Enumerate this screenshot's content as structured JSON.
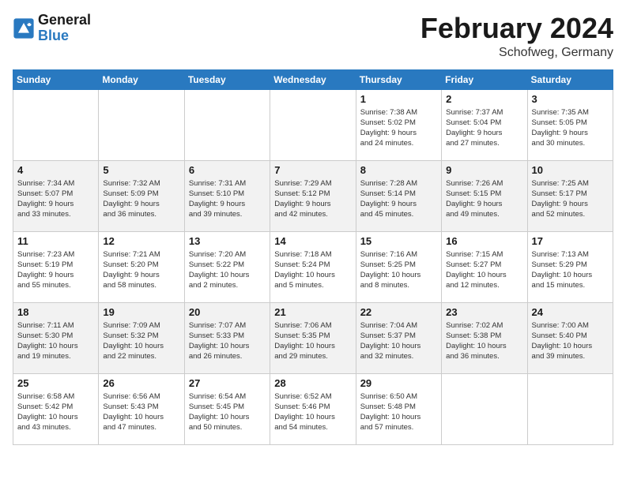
{
  "header": {
    "logo_line1": "General",
    "logo_line2": "Blue",
    "month_title": "February 2024",
    "location": "Schofweg, Germany"
  },
  "days_of_week": [
    "Sunday",
    "Monday",
    "Tuesday",
    "Wednesday",
    "Thursday",
    "Friday",
    "Saturday"
  ],
  "weeks": [
    [
      {
        "day": "",
        "info": ""
      },
      {
        "day": "",
        "info": ""
      },
      {
        "day": "",
        "info": ""
      },
      {
        "day": "",
        "info": ""
      },
      {
        "day": "1",
        "info": "Sunrise: 7:38 AM\nSunset: 5:02 PM\nDaylight: 9 hours\nand 24 minutes."
      },
      {
        "day": "2",
        "info": "Sunrise: 7:37 AM\nSunset: 5:04 PM\nDaylight: 9 hours\nand 27 minutes."
      },
      {
        "day": "3",
        "info": "Sunrise: 7:35 AM\nSunset: 5:05 PM\nDaylight: 9 hours\nand 30 minutes."
      }
    ],
    [
      {
        "day": "4",
        "info": "Sunrise: 7:34 AM\nSunset: 5:07 PM\nDaylight: 9 hours\nand 33 minutes."
      },
      {
        "day": "5",
        "info": "Sunrise: 7:32 AM\nSunset: 5:09 PM\nDaylight: 9 hours\nand 36 minutes."
      },
      {
        "day": "6",
        "info": "Sunrise: 7:31 AM\nSunset: 5:10 PM\nDaylight: 9 hours\nand 39 minutes."
      },
      {
        "day": "7",
        "info": "Sunrise: 7:29 AM\nSunset: 5:12 PM\nDaylight: 9 hours\nand 42 minutes."
      },
      {
        "day": "8",
        "info": "Sunrise: 7:28 AM\nSunset: 5:14 PM\nDaylight: 9 hours\nand 45 minutes."
      },
      {
        "day": "9",
        "info": "Sunrise: 7:26 AM\nSunset: 5:15 PM\nDaylight: 9 hours\nand 49 minutes."
      },
      {
        "day": "10",
        "info": "Sunrise: 7:25 AM\nSunset: 5:17 PM\nDaylight: 9 hours\nand 52 minutes."
      }
    ],
    [
      {
        "day": "11",
        "info": "Sunrise: 7:23 AM\nSunset: 5:19 PM\nDaylight: 9 hours\nand 55 minutes."
      },
      {
        "day": "12",
        "info": "Sunrise: 7:21 AM\nSunset: 5:20 PM\nDaylight: 9 hours\nand 58 minutes."
      },
      {
        "day": "13",
        "info": "Sunrise: 7:20 AM\nSunset: 5:22 PM\nDaylight: 10 hours\nand 2 minutes."
      },
      {
        "day": "14",
        "info": "Sunrise: 7:18 AM\nSunset: 5:24 PM\nDaylight: 10 hours\nand 5 minutes."
      },
      {
        "day": "15",
        "info": "Sunrise: 7:16 AM\nSunset: 5:25 PM\nDaylight: 10 hours\nand 8 minutes."
      },
      {
        "day": "16",
        "info": "Sunrise: 7:15 AM\nSunset: 5:27 PM\nDaylight: 10 hours\nand 12 minutes."
      },
      {
        "day": "17",
        "info": "Sunrise: 7:13 AM\nSunset: 5:29 PM\nDaylight: 10 hours\nand 15 minutes."
      }
    ],
    [
      {
        "day": "18",
        "info": "Sunrise: 7:11 AM\nSunset: 5:30 PM\nDaylight: 10 hours\nand 19 minutes."
      },
      {
        "day": "19",
        "info": "Sunrise: 7:09 AM\nSunset: 5:32 PM\nDaylight: 10 hours\nand 22 minutes."
      },
      {
        "day": "20",
        "info": "Sunrise: 7:07 AM\nSunset: 5:33 PM\nDaylight: 10 hours\nand 26 minutes."
      },
      {
        "day": "21",
        "info": "Sunrise: 7:06 AM\nSunset: 5:35 PM\nDaylight: 10 hours\nand 29 minutes."
      },
      {
        "day": "22",
        "info": "Sunrise: 7:04 AM\nSunset: 5:37 PM\nDaylight: 10 hours\nand 32 minutes."
      },
      {
        "day": "23",
        "info": "Sunrise: 7:02 AM\nSunset: 5:38 PM\nDaylight: 10 hours\nand 36 minutes."
      },
      {
        "day": "24",
        "info": "Sunrise: 7:00 AM\nSunset: 5:40 PM\nDaylight: 10 hours\nand 39 minutes."
      }
    ],
    [
      {
        "day": "25",
        "info": "Sunrise: 6:58 AM\nSunset: 5:42 PM\nDaylight: 10 hours\nand 43 minutes."
      },
      {
        "day": "26",
        "info": "Sunrise: 6:56 AM\nSunset: 5:43 PM\nDaylight: 10 hours\nand 47 minutes."
      },
      {
        "day": "27",
        "info": "Sunrise: 6:54 AM\nSunset: 5:45 PM\nDaylight: 10 hours\nand 50 minutes."
      },
      {
        "day": "28",
        "info": "Sunrise: 6:52 AM\nSunset: 5:46 PM\nDaylight: 10 hours\nand 54 minutes."
      },
      {
        "day": "29",
        "info": "Sunrise: 6:50 AM\nSunset: 5:48 PM\nDaylight: 10 hours\nand 57 minutes."
      },
      {
        "day": "",
        "info": ""
      },
      {
        "day": "",
        "info": ""
      }
    ]
  ]
}
